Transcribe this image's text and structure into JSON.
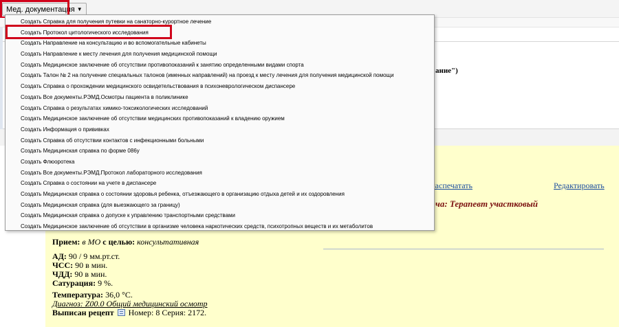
{
  "toolbar": {
    "menu_label": "Мед. документация"
  },
  "menu": {
    "items": [
      "Создать Справка для получения путевки на санаторно-курортное лечение",
      "Создать Протокол цитологического исследования",
      "Создать Направление на консультацию и во вспомогательные кабинеты",
      "Создать Направление к месту лечения для получения медицинской помощи",
      "Создать Медицинское заключение об отсутствии противопоказаний к занятию определенными видами спорта",
      "Создать Талон № 2 на получение специальных талонов (именных направлений) на проезд к месту лечения для получения медицинской помощи",
      "Создать Справка о прохождении медицинского освидетельствования в психоневрологическом диспансере",
      "Создать Все документы.РЭМД.Осмотры пациента в поликлинике",
      "Создать Справка о результатах химико-токсикологических исследований",
      "Создать Медицинское заключение об отсутствии медицинских противопоказаний к владению оружием",
      "Создать Информация о прививках",
      "Создать Справка об отсутствии контактов с инфекционными больными",
      "Создать Медицинская справка по форме 086у",
      "Создать Флюоротека",
      "Создать Все документы.РЭМД.Протокол лабораторного исследования",
      "Создать Справка о состоянии на учете в диспансере",
      "Создать Медицинская справка о состоянии здоровья ребенка, отъезжающего в организацию отдыха детей и их оздоровления",
      "Создать Медицинская справка (для выезжающего за границу)",
      "Создать Медицинская справка о допуске к управлению транспортными средствами",
      "Создать Медицинское заключение об отсутствии в организме человека наркотических средств, психотропных веществ и их метаболитов"
    ]
  },
  "background": {
    "upper_fragment": "ание\")",
    "print_link": "Распечатать",
    "edit_link": "Редактировать",
    "doctor_fragment": "ча: Терапевт участковый"
  },
  "visit": {
    "reception_label": "Прием:",
    "reception_place": "в МО",
    "purpose_label": "с целью:",
    "purpose_value": "консультативная",
    "bp_label": "АД:",
    "bp_value": "90 / 9 мм.рт.ст.",
    "hr_label": "ЧСС:",
    "hr_value": "90 в мин.",
    "rr_label": "ЧДД:",
    "rr_value": "90 в мин.",
    "sat_label": "Сатурация:",
    "sat_value": "9 %.",
    "temp_label": "Температура:",
    "temp_value": "36,0 °С.",
    "diagnosis": "Диагноз: Z00.0 Общий медицинский осмотр",
    "rx_label": "Выписан рецепт",
    "rx_value": "Номер: 8 Серия: 2172."
  },
  "colors": {
    "highlight": "#d0021b",
    "yellow_panel": "#ffffcc",
    "link": "#1a4c9e",
    "doctor_text": "#7a0f0f"
  }
}
